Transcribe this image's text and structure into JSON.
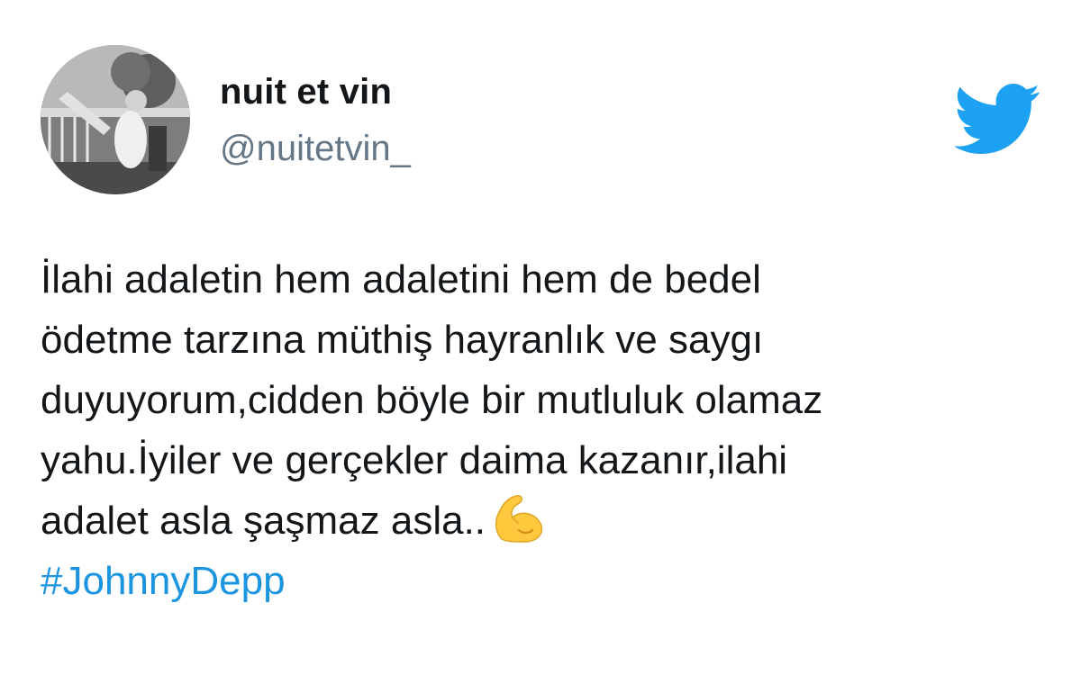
{
  "author": {
    "display_name": "nuit et vin",
    "handle": "@nuitetvin_",
    "avatar_icon": "profile-photo"
  },
  "platform": {
    "logo_icon": "twitter-bird-icon",
    "brand_color": "#1da1f2"
  },
  "tweet": {
    "lines": [
      "İlahi adaletin hem adaletini hem de bedel",
      "ödetme tarzına müthiş hayranlık ve saygı",
      "duyuyorum,cidden böyle bir mutluluk olamaz",
      "yahu.İyiler ve gerçekler daima kazanır,ilahi",
      "adalet asla şaşmaz asla.."
    ],
    "emoji": "flexed-biceps-emoji",
    "hashtag": "#JohnnyDepp",
    "hashtag_color": "#1b95e0"
  }
}
